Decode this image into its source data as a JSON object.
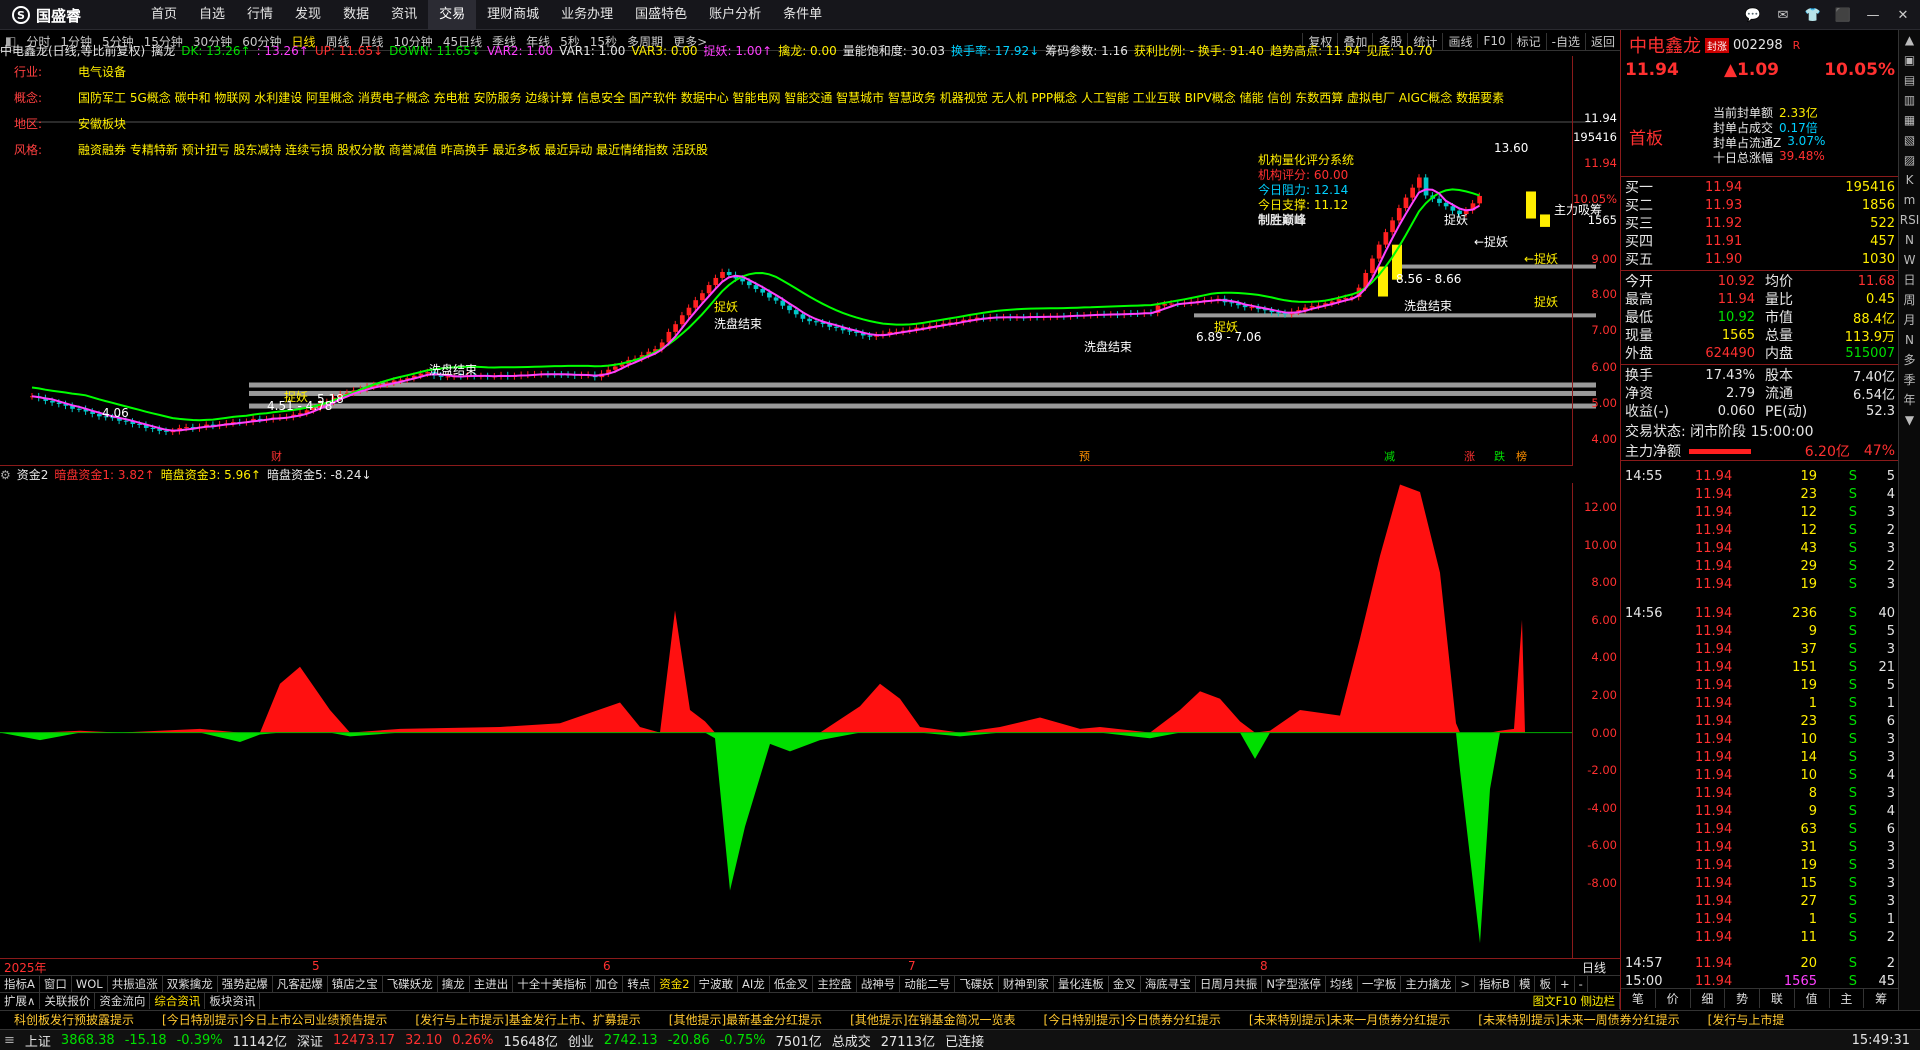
{
  "app": {
    "logo": "国盛睿",
    "logo_mark": "S"
  },
  "nav": [
    "首页",
    "自选",
    "行情",
    "发现",
    "数据",
    "资讯",
    "交易",
    "理财商城",
    "业务办理",
    "国盛特色",
    "账户分析",
    "条件单"
  ],
  "nav_active": 6,
  "window_controls": [
    "💬",
    "✉",
    "👕",
    "⬛",
    "—",
    "✕"
  ],
  "periods": [
    "分时",
    "1分钟",
    "5分钟",
    "15分钟",
    "30分钟",
    "60分钟",
    "日线",
    "周线",
    "月线",
    "10分钟",
    "45日线",
    "季线",
    "年线",
    "5秒",
    "15秒",
    "多周期",
    "更多>"
  ],
  "period_active": 6,
  "ptools": [
    "复权",
    "叠加",
    "多股",
    "统计",
    "画线",
    "F10",
    "标记",
    "-自选",
    "返回"
  ],
  "indicator_line": [
    {
      "t": "中电鑫龙(日线,等比前复权)",
      "c": "w"
    },
    {
      "t": "擒龙",
      "c": "w"
    },
    {
      "t": "DK: 13.26↑",
      "c": "g"
    },
    {
      "t": ": 13.26↑",
      "c": "m"
    },
    {
      "t": "UP: 11.65↓",
      "c": "r"
    },
    {
      "t": "DOWN: 11.65↓",
      "c": "g"
    },
    {
      "t": "VAR2: 1.00",
      "c": "m"
    },
    {
      "t": "VAR1: 1.00",
      "c": "w"
    },
    {
      "t": "VAR3: 0.00",
      "c": "y"
    },
    {
      "t": "捉妖: 1.00↑",
      "c": "m"
    },
    {
      "t": "擒龙: 0.00",
      "c": "y"
    },
    {
      "t": "量能饱和度: 30.03",
      "c": "w"
    },
    {
      "t": "换手率: 17.92↓",
      "c": "c"
    },
    {
      "t": "筹码参数: 1.16",
      "c": "w"
    },
    {
      "t": "获利比例: - 换手: 91.40",
      "c": "y"
    },
    {
      "t": "趋势高点: 11.94",
      "c": "y"
    },
    {
      "t": "见底: 10.70",
      "c": "y"
    }
  ],
  "info_rows": [
    {
      "label": "行业:",
      "value": "电气设备"
    },
    {
      "label": "概念:",
      "value": "国防军工 5G概念 碳中和 物联网 水利建设 阿里概念 消费电子概念 充电桩 安防服务 边缘计算 信息安全 国产软件 数据中心 智能电网 智能交通 智慧城市 智慧政务 机器视觉 无人机 PPP概念 人工智能 工业互联 BIPV概念 储能 信创 东数西算 虚拟电厂 AIGC概念 数据要素"
    },
    {
      "label": "地区:",
      "value": "安徽板块"
    },
    {
      "label": "风格:",
      "value": "融资融券 专精特新 预计扭亏 股东减持 连续亏损 股权分散 商誉减值 昨高换手 最近多板 最近异动 最近情绪指数 活跃股"
    }
  ],
  "rating": {
    "title": "机构量化评分系统",
    "score_label": "机构评分:",
    "score": "60.00",
    "resist_label": "今日阻力:",
    "resist": "12.14",
    "support_label": "今日支撑:",
    "support": "11.12",
    "verdict": "制胜巅峰"
  },
  "main_yaxis": [
    "11.94",
    "195416",
    "11.94",
    "10.05%",
    "1565",
    "9.00",
    "8.00",
    "7.00",
    "6.00",
    "5.00",
    "4.00"
  ],
  "chart_labels": [
    "捉妖",
    "捉妖",
    "洗盘结束",
    "洗盘结束",
    "洗盘结束",
    "捉妖",
    "洗盘结束",
    "捉妖",
    "←捉妖",
    "←捉妖",
    "主力吸筹",
    "捉妖",
    "13.60",
    "8.56 - 8.66",
    "6.89 - 7.06",
    "4.51 - 4.78",
    "5.18",
    "4.06"
  ],
  "event_marks": [
    "财",
    "预",
    "减",
    "涨",
    "跌",
    "榜"
  ],
  "lower_header": [
    {
      "t": "资金2",
      "c": "w"
    },
    {
      "t": "暗盘资金1: 3.82↑",
      "c": "r"
    },
    {
      "t": "暗盘资金3: 5.96↑",
      "c": "y"
    },
    {
      "t": "暗盘资金5: -8.24↓",
      "c": "w"
    }
  ],
  "lower_yaxis": [
    "12.00",
    "10.00",
    "8.00",
    "6.00",
    "4.00",
    "2.00",
    "0.00",
    "-2.00",
    "-4.00",
    "-6.00",
    "-8.00"
  ],
  "xaxis": {
    "year": "2025年",
    "months": [
      "5",
      "6",
      "7",
      "8"
    ],
    "unit": "日线"
  },
  "tabs1": [
    "指标A",
    "窗口",
    "WOL",
    "共振追涨",
    "双紫擒龙",
    "强势起爆",
    "凡客起爆",
    "镇店之宝",
    "飞碟妖龙",
    "擒龙",
    "主进出",
    "十全十美指标",
    "加仓",
    "转点",
    "资金2",
    "宁波敢",
    "AI龙",
    "低金叉",
    "主控盘",
    "战神号",
    "动能二号",
    "飞碟妖",
    "财神到家",
    "量化连板",
    "金叉",
    "海底寻宝",
    "日周月共振",
    "N字型涨停",
    "均线",
    "一字板",
    "主力擒龙",
    ">",
    "指标B",
    "模",
    "板",
    "+",
    "-"
  ],
  "tabs1_active": 14,
  "tabs2": [
    "扩展∧",
    "关联报价",
    "资金流向",
    "综合资讯",
    "板块资讯"
  ],
  "tabs2_right": "图文F10 侧边栏",
  "news": [
    "科创板发行预披露提示",
    "[今日特别提示]今日上市公司业绩预告提示",
    "[发行与上市提示]基金发行上市、扩募提示",
    "[其他提示]最新基金分红提示",
    "[其他提示]在销基金简况一览表",
    "[今日特别提示]今日债券分红提示",
    "[未来特别提示]未来一月债券分红提示",
    "[未来特别提示]未来一周债券分红提示",
    "[发行与上市提"
  ],
  "status": {
    "sh_label": "上证",
    "sh": "3868.38",
    "sh_chg": "-15.18",
    "sh_pct": "-0.39%",
    "sh_amt": "11142亿",
    "sz_label": "深证",
    "sz": "12473.17",
    "sz_chg": "32.10",
    "sz_pct": "0.26%",
    "sz_amt": "15648亿",
    "cy_label": "创业",
    "cy": "2742.13",
    "cy_chg": "-20.86",
    "cy_pct": "-0.75%",
    "cy_amt": "7501亿",
    "total_label": "总成交",
    "total": "27113亿",
    "conn": "已连接",
    "time": "15:49:31"
  },
  "quote": {
    "name": "中电鑫龙",
    "badge": "封涨",
    "code": "002298",
    "flag": "R",
    "price": "11.94",
    "change": "▲1.09",
    "pct": "10.05%",
    "sealed": [
      {
        "l": "当前封单额",
        "v": "2.33亿"
      },
      {
        "l": "封单占成交",
        "v": "0.17倍"
      },
      {
        "l": "封单占流通Z",
        "v": "3.07%"
      },
      {
        "l": "十日总涨幅",
        "v": "39.48%"
      }
    ],
    "first_board": "首板",
    "bids": [
      {
        "l": "买一",
        "p": "11.94",
        "v": "195416"
      },
      {
        "l": "买二",
        "p": "11.93",
        "v": "1856"
      },
      {
        "l": "买三",
        "p": "11.92",
        "v": "522"
      },
      {
        "l": "买四",
        "p": "11.91",
        "v": "457"
      },
      {
        "l": "买五",
        "p": "11.90",
        "v": "1030"
      }
    ],
    "stats": [
      {
        "l1": "今开",
        "v1": "10.92",
        "l2": "均价",
        "v2": "11.68"
      },
      {
        "l1": "最高",
        "v1": "11.94",
        "l2": "量比",
        "v2": "0.45"
      },
      {
        "l1": "最低",
        "v1": "10.92",
        "l2": "市值",
        "v2": "88.4亿"
      },
      {
        "l1": "现量",
        "v1": "1565",
        "l2": "总量",
        "v2": "113.9万"
      },
      {
        "l1": "外盘",
        "v1": "624490",
        "l2": "内盘",
        "v2": "515007"
      }
    ],
    "stats2": [
      {
        "l1": "换手",
        "v1": "17.43%",
        "l2": "股本",
        "v2": "7.40亿"
      },
      {
        "l1": "净资",
        "v1": "2.79",
        "l2": "流通",
        "v2": "6.54亿"
      },
      {
        "l1": "收益(-)",
        "v1": "0.060",
        "l2": "PE(动)",
        "v2": "52.3"
      }
    ],
    "trade_status": "交易状态: 闭市阶段 15:00:00",
    "main_net_label": "主力净额",
    "main_net": "6.20亿",
    "main_net_pct": "47%"
  },
  "ticks": [
    {
      "t": "14:55",
      "p": "11.94",
      "v": "19",
      "s": "S",
      "n": "5"
    },
    {
      "t": "",
      "p": "11.94",
      "v": "23",
      "s": "S",
      "n": "4"
    },
    {
      "t": "",
      "p": "11.94",
      "v": "12",
      "s": "S",
      "n": "3"
    },
    {
      "t": "",
      "p": "11.94",
      "v": "12",
      "s": "S",
      "n": "2"
    },
    {
      "t": "",
      "p": "11.94",
      "v": "43",
      "s": "S",
      "n": "3"
    },
    {
      "t": "",
      "p": "11.94",
      "v": "29",
      "s": "S",
      "n": "2"
    },
    {
      "t": "",
      "p": "11.94",
      "v": "19",
      "s": "S",
      "n": "3"
    },
    {
      "t": "14:56",
      "p": "11.94",
      "v": "236",
      "s": "S",
      "n": "40"
    },
    {
      "t": "",
      "p": "11.94",
      "v": "9",
      "s": "S",
      "n": "5"
    },
    {
      "t": "",
      "p": "11.94",
      "v": "37",
      "s": "S",
      "n": "3"
    },
    {
      "t": "",
      "p": "11.94",
      "v": "151",
      "s": "S",
      "n": "21"
    },
    {
      "t": "",
      "p": "11.94",
      "v": "19",
      "s": "S",
      "n": "5"
    },
    {
      "t": "",
      "p": "11.94",
      "v": "1",
      "s": "S",
      "n": "1"
    },
    {
      "t": "",
      "p": "11.94",
      "v": "23",
      "s": "S",
      "n": "6"
    },
    {
      "t": "",
      "p": "11.94",
      "v": "10",
      "s": "S",
      "n": "3"
    },
    {
      "t": "",
      "p": "11.94",
      "v": "14",
      "s": "S",
      "n": "3"
    },
    {
      "t": "",
      "p": "11.94",
      "v": "10",
      "s": "S",
      "n": "4"
    },
    {
      "t": "",
      "p": "11.94",
      "v": "8",
      "s": "S",
      "n": "3"
    },
    {
      "t": "",
      "p": "11.94",
      "v": "9",
      "s": "S",
      "n": "4"
    },
    {
      "t": "",
      "p": "11.94",
      "v": "63",
      "s": "S",
      "n": "6"
    },
    {
      "t": "",
      "p": "11.94",
      "v": "31",
      "s": "S",
      "n": "3"
    },
    {
      "t": "",
      "p": "11.94",
      "v": "19",
      "s": "S",
      "n": "3"
    },
    {
      "t": "",
      "p": "11.94",
      "v": "15",
      "s": "S",
      "n": "3"
    },
    {
      "t": "",
      "p": "11.94",
      "v": "27",
      "s": "S",
      "n": "3"
    },
    {
      "t": "",
      "p": "11.94",
      "v": "1",
      "s": "S",
      "n": "1"
    },
    {
      "t": "",
      "p": "11.94",
      "v": "11",
      "s": "S",
      "n": "2"
    },
    {
      "t": "14:57",
      "p": "11.94",
      "v": "20",
      "s": "S",
      "n": "2"
    },
    {
      "t": "15:00",
      "p": "11.94",
      "v": "1565",
      "s": "S",
      "n": "45"
    }
  ],
  "side_tabs": [
    "笔",
    "价",
    "细",
    "势",
    "联",
    "值",
    "主",
    "筹"
  ],
  "right_tools": [
    "▲",
    "▣",
    "▤",
    "▥",
    "▦",
    "▧",
    "▨",
    "K",
    "m",
    "RSI",
    "N",
    "W",
    "日",
    "周",
    "月",
    "N",
    "多",
    "季",
    "年",
    "▼"
  ]
}
